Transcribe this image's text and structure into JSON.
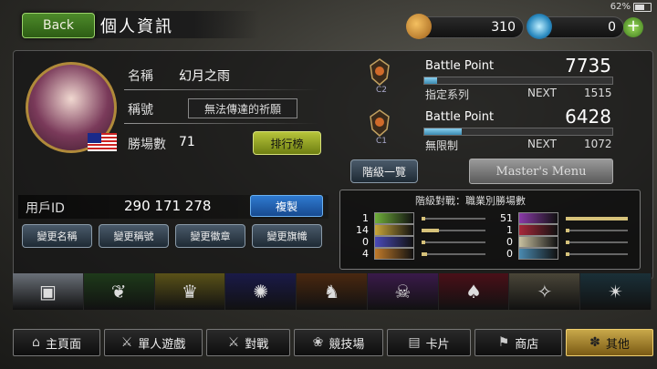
{
  "status": {
    "battery": "62%"
  },
  "header": {
    "back_label": "Back",
    "title": "個人資訊"
  },
  "resources": {
    "coins": "310",
    "gems": "0",
    "add_label": "+"
  },
  "profile": {
    "name_label": "名稱",
    "name_value": "幻月之雨",
    "title_label": "稱號",
    "title_value": "無法傳達的祈願",
    "wins_label": "勝場數",
    "wins_value": "71",
    "ranking_button": "排行榜",
    "user_id_label": "用戶ID",
    "user_id_value": "290 171 278",
    "copy_button": "複製",
    "change_buttons": [
      "變更名稱",
      "變更稱號",
      "變更徽章",
      "變更旗幟"
    ]
  },
  "battle": [
    {
      "rank_badge": "C2",
      "label": "Battle Point",
      "points": "7735",
      "mode": "指定系列",
      "next_label": "NEXT",
      "next_value": "1515",
      "progress": 0.07
    },
    {
      "rank_badge": "C1",
      "label": "Battle Point",
      "points": "6428",
      "mode": "無限制",
      "next_label": "NEXT",
      "next_value": "1072",
      "progress": 0.2
    }
  ],
  "rank_list_button": "階級一覽",
  "master_menu_button": "Master's Menu",
  "class_wins": {
    "title": "階級對戰：職業別勝場數",
    "left": [
      {
        "count": "1",
        "class": "forestcraft",
        "color": "#6fae3a",
        "ratio": 0.02
      },
      {
        "count": "14",
        "class": "swordcraft",
        "color": "#c8a63a",
        "ratio": 0.27
      },
      {
        "count": "0",
        "class": "runecraft",
        "color": "#4a4ab8",
        "ratio": 0.0
      },
      {
        "count": "4",
        "class": "dragoncraft",
        "color": "#c07a2a",
        "ratio": 0.08
      }
    ],
    "right": [
      {
        "count": "51",
        "class": "shadowcraft",
        "color": "#8a3aa8",
        "ratio": 1.0
      },
      {
        "count": "1",
        "class": "bloodcraft",
        "color": "#a8283a",
        "ratio": 0.02
      },
      {
        "count": "0",
        "class": "havencraft",
        "color": "#c8c0a0",
        "ratio": 0.0
      },
      {
        "count": "0",
        "class": "portalcraft",
        "color": "#4a8ab0",
        "ratio": 0.0
      }
    ]
  },
  "class_tabs": [
    {
      "name": "profile",
      "icon": "cards-icon",
      "glyph": "▣",
      "bg": "#6a7078"
    },
    {
      "name": "forest",
      "icon": "leaf-icon",
      "glyph": "❦",
      "bg": "#1e3a1a"
    },
    {
      "name": "sword",
      "icon": "crown-icon",
      "glyph": "♛",
      "bg": "#5a5218"
    },
    {
      "name": "rune",
      "icon": "rune-icon",
      "glyph": "✺",
      "bg": "#1a1a48"
    },
    {
      "name": "dragon",
      "icon": "dragon-icon",
      "glyph": "♞",
      "bg": "#4a2810"
    },
    {
      "name": "shadow",
      "icon": "skull-icon",
      "glyph": "☠",
      "bg": "#3a1a4a"
    },
    {
      "name": "blood",
      "icon": "bat-icon",
      "glyph": "♠",
      "bg": "#4a1018"
    },
    {
      "name": "haven",
      "icon": "wing-icon",
      "glyph": "✧",
      "bg": "#4a4638"
    },
    {
      "name": "portal",
      "icon": "portal-icon",
      "glyph": "✴",
      "bg": "#1a3038"
    }
  ],
  "nav": [
    {
      "label": "主頁面",
      "icon": "home-icon",
      "glyph": "⌂"
    },
    {
      "label": "單人遊戲",
      "icon": "sword-icon",
      "glyph": "⚔"
    },
    {
      "label": "對戰",
      "icon": "crossed-swords-icon",
      "glyph": "⚔"
    },
    {
      "label": "競技場",
      "icon": "laurel-icon",
      "glyph": "❀"
    },
    {
      "label": "卡片",
      "icon": "cards-icon",
      "glyph": "▤"
    },
    {
      "label": "商店",
      "icon": "shop-icon",
      "glyph": "⚑"
    },
    {
      "label": "其他",
      "icon": "other-icon",
      "glyph": "✽",
      "active": true
    }
  ]
}
